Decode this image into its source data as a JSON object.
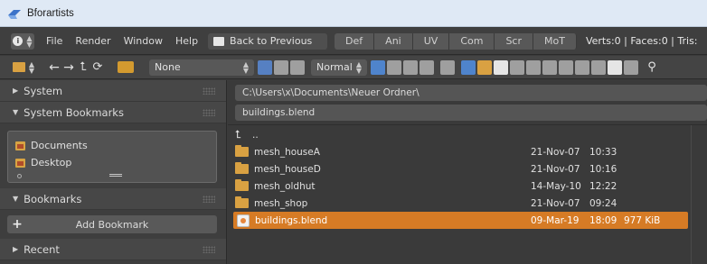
{
  "window": {
    "title": "Bforartists"
  },
  "header": {
    "menus": [
      "File",
      "Render",
      "Window",
      "Help"
    ],
    "back_button": "Back to Previous",
    "tabs": [
      "Def",
      "Ani",
      "UV",
      "Com",
      "Scr",
      "MoT"
    ],
    "stats": "Verts:0 | Faces:0 | Tris:"
  },
  "toolbar": {
    "filter_dropdown": "None",
    "display_dropdown": "Normal"
  },
  "sidebar": {
    "system": "System",
    "system_bookmarks": "System Bookmarks",
    "bookmark_items": [
      "Documents",
      "Desktop"
    ],
    "bookmarks": "Bookmarks",
    "add_bookmark": "Add Bookmark",
    "recent": "Recent"
  },
  "file_browser": {
    "directory": "C:\\Users\\x\\Documents\\Neuer Ordner\\",
    "filename": "buildings.blend",
    "parent_label": "..",
    "files": [
      {
        "name": "mesh_houseA",
        "date": "21-Nov-07",
        "time": "10:33",
        "size": "",
        "type": "folder"
      },
      {
        "name": "mesh_houseD",
        "date": "21-Nov-07",
        "time": "10:16",
        "size": "",
        "type": "folder"
      },
      {
        "name": "mesh_oldhut",
        "date": "14-May-10",
        "time": "12:22",
        "size": "",
        "type": "folder"
      },
      {
        "name": "mesh_shop",
        "date": "21-Nov-07",
        "time": "09:24",
        "size": "",
        "type": "folder"
      },
      {
        "name": "buildings.blend",
        "date": "09-Mar-19",
        "time": "18:09",
        "size": "977 KiB",
        "type": "blend"
      }
    ]
  },
  "colors": {
    "selection": "#d67b25",
    "titlebar": "#dfe9f5"
  }
}
